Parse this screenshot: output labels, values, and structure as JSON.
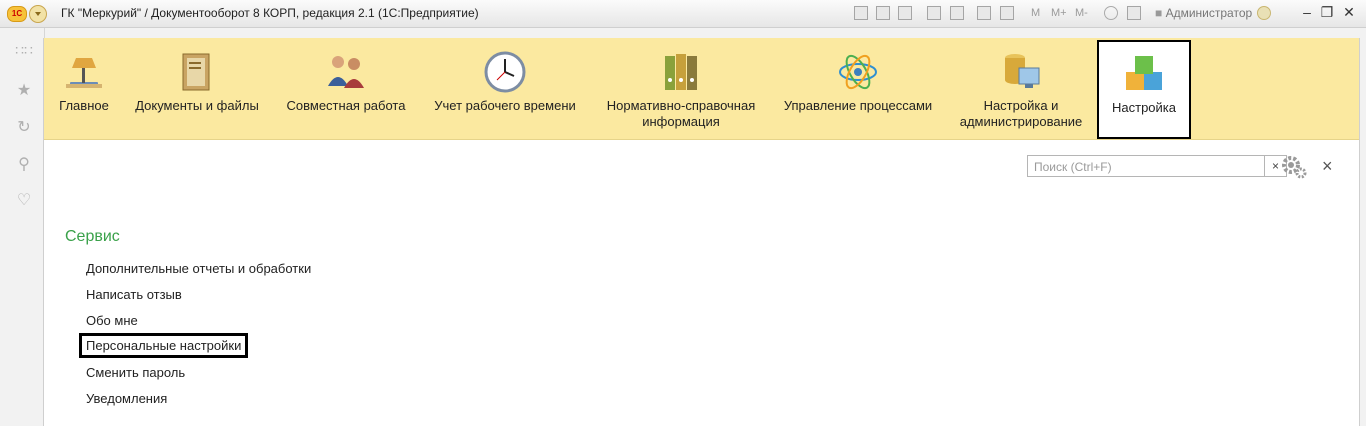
{
  "window": {
    "title": "ГК \"Меркурий\" / Документооборот 8 КОРП, редакция 2.1  (1С:Предприятие)",
    "logo": "1С",
    "user": "Администратор",
    "toolbar_text": [
      "M",
      "M+",
      "M-"
    ]
  },
  "sections": [
    {
      "label": "Главное",
      "icon": "desk-lamp-icon"
    },
    {
      "label": "Документы и файлы",
      "icon": "folder-documents-icon"
    },
    {
      "label": "Совместная работа",
      "icon": "people-icon"
    },
    {
      "label": "Учет рабочего времени",
      "icon": "clock-icon"
    },
    {
      "label": "Нормативно-справочная информация",
      "icon": "binders-icon"
    },
    {
      "label": "Управление процессами",
      "icon": "process-atom-icon"
    },
    {
      "label": "Настройка и администрирование",
      "icon": "database-server-icon"
    },
    {
      "label": "Настройка",
      "icon": "cubes-icon"
    }
  ],
  "search": {
    "placeholder": "Поиск (Ctrl+F)",
    "clear": "×"
  },
  "close_label": "×",
  "group": {
    "title": "Сервис",
    "items": [
      "Дополнительные отчеты и обработки",
      "Написать отзыв",
      "Обо мне",
      "Персональные настройки",
      "Сменить пароль",
      "Уведомления"
    ]
  },
  "colors": {
    "panel_bg": "#fbe9a0",
    "group_title": "#3aa14a"
  }
}
